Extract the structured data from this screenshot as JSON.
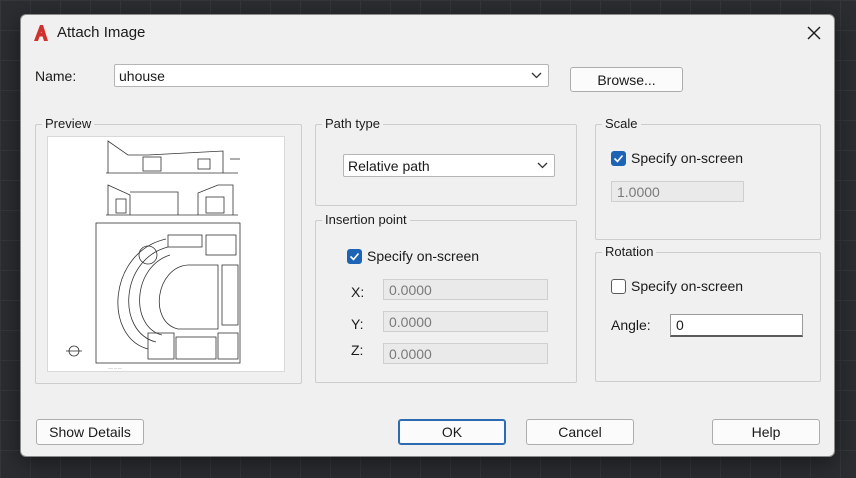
{
  "dialog": {
    "title": "Attach Image",
    "close_icon": "close-icon",
    "app_icon": "autocad-logo-icon"
  },
  "name": {
    "label": "Name:",
    "value": "uhouse",
    "browse_label": "Browse..."
  },
  "preview": {
    "title": "Preview"
  },
  "path_type": {
    "title": "Path type",
    "selected": "Relative path"
  },
  "insertion_point": {
    "title": "Insertion point",
    "specify_label": "Specify on-screen",
    "specify_checked": true,
    "x_label": "X:",
    "x_value": "0.0000",
    "y_label": "Y:",
    "y_value": "0.0000",
    "z_label": "Z:",
    "z_value": "0.0000"
  },
  "scale": {
    "title": "Scale",
    "specify_label": "Specify on-screen",
    "specify_checked": true,
    "value": "1.0000"
  },
  "rotation": {
    "title": "Rotation",
    "specify_label": "Specify on-screen",
    "specify_checked": false,
    "angle_label": "Angle:",
    "angle_value": "0"
  },
  "footer": {
    "show_details_label": "Show Details",
    "ok_label": "OK",
    "cancel_label": "Cancel",
    "help_label": "Help"
  },
  "colors": {
    "accent": "#1e64b4",
    "logo_red": "#d0312d"
  }
}
